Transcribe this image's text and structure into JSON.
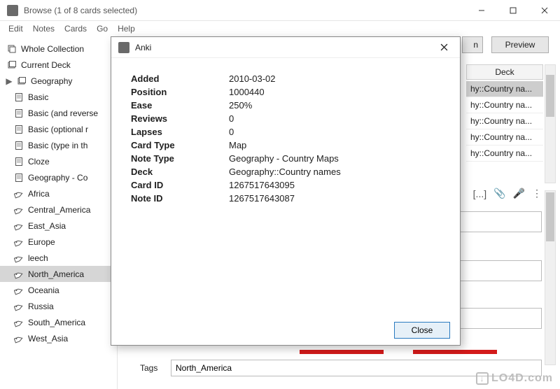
{
  "window": {
    "title": "Browse (1 of 8 cards selected)"
  },
  "menu": {
    "edit": "Edit",
    "notes": "Notes",
    "cards": "Cards",
    "go": "Go",
    "help": "Help"
  },
  "sidebar": {
    "items": [
      {
        "label": "Whole Collection",
        "icon": "stack"
      },
      {
        "label": "Current Deck",
        "icon": "deck"
      },
      {
        "label": "Geography",
        "icon": "deck",
        "expandable": true
      },
      {
        "label": "Basic",
        "icon": "note"
      },
      {
        "label": "Basic (and reverse",
        "icon": "note"
      },
      {
        "label": "Basic (optional r",
        "icon": "note"
      },
      {
        "label": "Basic (type in th",
        "icon": "note"
      },
      {
        "label": "Cloze",
        "icon": "note"
      },
      {
        "label": "Geography - Co",
        "icon": "note"
      },
      {
        "label": "Africa",
        "icon": "tag"
      },
      {
        "label": "Central_America",
        "icon": "tag"
      },
      {
        "label": "East_Asia",
        "icon": "tag"
      },
      {
        "label": "Europe",
        "icon": "tag"
      },
      {
        "label": "leech",
        "icon": "tag"
      },
      {
        "label": "North_America",
        "icon": "tag",
        "selected": true
      },
      {
        "label": "Oceania",
        "icon": "tag"
      },
      {
        "label": "Russia",
        "icon": "tag"
      },
      {
        "label": "South_America",
        "icon": "tag"
      },
      {
        "label": "West_Asia",
        "icon": "tag"
      }
    ]
  },
  "right": {
    "preview": "Preview",
    "hidden_suffix": "n",
    "deck_header": "Deck",
    "deck_rows": [
      "hy::Country na...",
      "hy::Country na...",
      "hy::Country na...",
      "hy::Country na...",
      "hy::Country na..."
    ],
    "icons": {
      "brackets": "[...]",
      "clip": "📎",
      "mic": "🎤",
      "more": "⋮"
    }
  },
  "tags": {
    "label": "Tags",
    "value": "North_America"
  },
  "dialog": {
    "title": "Anki",
    "rows": [
      {
        "k": "Added",
        "v": "2010-03-02"
      },
      {
        "k": "Position",
        "v": "1000440"
      },
      {
        "k": "Ease",
        "v": "250%"
      },
      {
        "k": "Reviews",
        "v": "0"
      },
      {
        "k": "Lapses",
        "v": "0"
      },
      {
        "k": "Card Type",
        "v": "Map"
      },
      {
        "k": "Note Type",
        "v": "Geography - Country Maps"
      },
      {
        "k": "Deck",
        "v": "Geography::Country names"
      },
      {
        "k": "Card ID",
        "v": "1267517643095"
      },
      {
        "k": "Note ID",
        "v": "1267517643087"
      }
    ],
    "close": "Close"
  },
  "watermark": "LO4D.com"
}
